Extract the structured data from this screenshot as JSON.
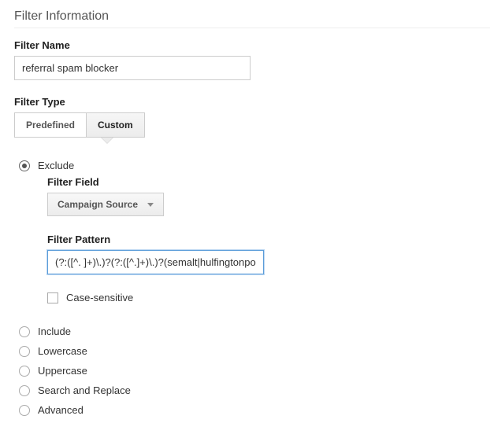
{
  "section_title": "Filter Information",
  "filter_name": {
    "label": "Filter Name",
    "value": "referral spam blocker"
  },
  "filter_type": {
    "label": "Filter Type",
    "tabs": {
      "predefined": "Predefined",
      "custom": "Custom"
    },
    "active_tab": "custom"
  },
  "options": {
    "exclude": "Exclude",
    "include": "Include",
    "lowercase": "Lowercase",
    "uppercase": "Uppercase",
    "search_replace": "Search and Replace",
    "advanced": "Advanced",
    "selected": "exclude"
  },
  "exclude_panel": {
    "filter_field": {
      "label": "Filter Field",
      "value": "Campaign Source"
    },
    "filter_pattern": {
      "label": "Filter Pattern",
      "value": "(?:([^. ]+)\\.)?(?:([^.]+)\\.)?(semalt|hulfingtonpos"
    },
    "case_sensitive": {
      "label": "Case-sensitive",
      "checked": false
    }
  }
}
